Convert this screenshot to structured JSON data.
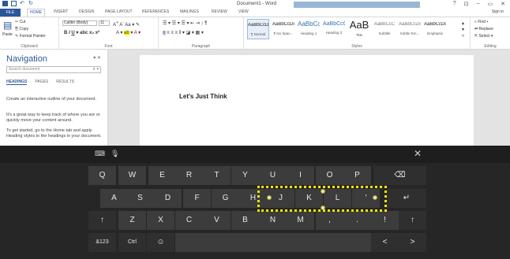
{
  "window": {
    "title": "Document1 - Word",
    "controls": [
      "?",
      "⊡",
      "–",
      "▭",
      "✕"
    ],
    "sign_in": "Sign in"
  },
  "tabs": [
    "FILE",
    "HOME",
    "INSERT",
    "DESIGN",
    "PAGE LAYOUT",
    "REFERENCES",
    "MAILINGS",
    "REVIEW",
    "VIEW"
  ],
  "ribbon": {
    "clipboard": {
      "label": "Clipboard",
      "paste": "Paste",
      "cut": "Cut",
      "copy": "Copy",
      "format_painter": "Format Painter"
    },
    "font": {
      "label": "Font",
      "family": "Calibri (Body)",
      "size": "11"
    },
    "paragraph": {
      "label": "Paragraph"
    },
    "styles": {
      "label": "Styles",
      "items": [
        {
          "sample": "AaBbCcDc",
          "name": "¶ Normal"
        },
        {
          "sample": "AaBbCcDc",
          "name": "¶ No Spac..."
        },
        {
          "sample": "AaBbCc",
          "name": "Heading 1"
        },
        {
          "sample": "AaBbCcC",
          "name": "Heading 2"
        },
        {
          "sample": "AaB",
          "name": "Title"
        },
        {
          "sample": "AaBbCcC",
          "name": "Subtitle"
        },
        {
          "sample": "AaBbCcDc",
          "name": "Subtle Em..."
        },
        {
          "sample": "AaBbCcDc",
          "name": "Emphasis"
        }
      ]
    },
    "editing": {
      "label": "Editing",
      "find": "Find",
      "replace": "Replace",
      "select": "Select"
    }
  },
  "navigation": {
    "title": "Navigation",
    "search_placeholder": "Search document",
    "tabs": [
      "HEADINGS",
      "PAGES",
      "RESULTS"
    ],
    "para1": "Create an interactive outline of your document.",
    "para2": "It's a great way to keep track of where you are or quickly move your content around.",
    "para3": "To get started, go to the Home tab and apply Heading styles to the headings in your document."
  },
  "document": {
    "text": "Let's Just Think"
  },
  "keyboard": {
    "row1": [
      "Q",
      "W",
      "E",
      "R",
      "T",
      "Y",
      "U",
      "I",
      "O",
      "P",
      "⌫"
    ],
    "row2": [
      "A",
      "S",
      "D",
      "F",
      "G",
      "H",
      "J",
      "K",
      "L",
      "'",
      "↵"
    ],
    "row3": [
      "↑",
      "Z",
      "X",
      "C",
      "V",
      "B",
      "N",
      "M",
      ",",
      ".",
      "!",
      "↑"
    ],
    "row4": [
      "&123",
      "Ctrl",
      "☺",
      "",
      "<",
      ">"
    ],
    "close": "✕",
    "highlight_color": "#f4e400"
  }
}
